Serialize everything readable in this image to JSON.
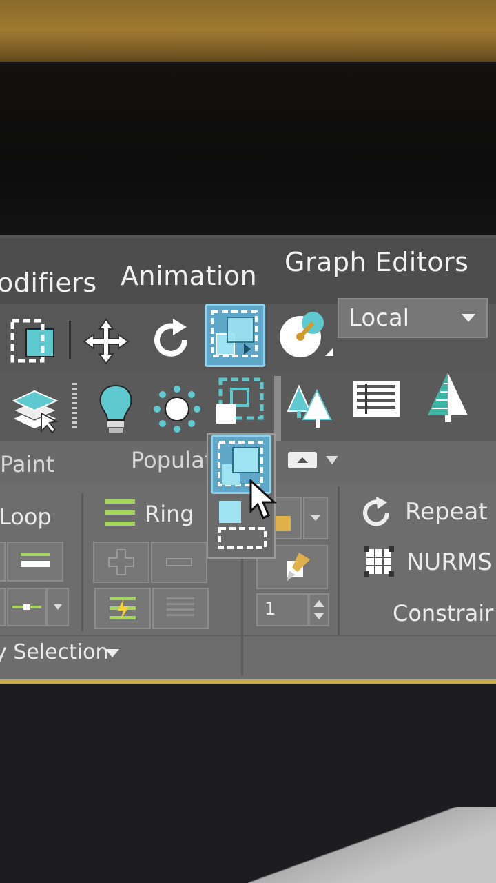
{
  "menu": {
    "modifiers": "odifiers",
    "animation": "Animation",
    "graph_editors": "Graph Editors"
  },
  "toolbar": {
    "coord_system": "Local",
    "row1_icons": [
      "select-region-icon",
      "move-icon",
      "rotate-icon",
      "select-window-crossing-icon",
      "snaps-icon"
    ],
    "row2_icons": [
      "layers-icon",
      "light-icon",
      "sun-icon",
      "region-select-icon",
      "scatter-trees-icon",
      "scene-explorer-icon",
      "forest-icon"
    ]
  },
  "ribbon_tabs": {
    "paint": "Paint",
    "populate": "Populat"
  },
  "ribbon": {
    "loop": "Loop",
    "ring": "Ring",
    "repeat": "Repeat",
    "nurms": "NURMS",
    "constraints": "Constrair",
    "selection_footer": "y Selection",
    "spinner_value": "1"
  },
  "colors": {
    "accent": "#5fc9d0",
    "active_button": "#5fa7c8",
    "ui_gray": "#575757",
    "ring_green": "#a4d65e"
  }
}
